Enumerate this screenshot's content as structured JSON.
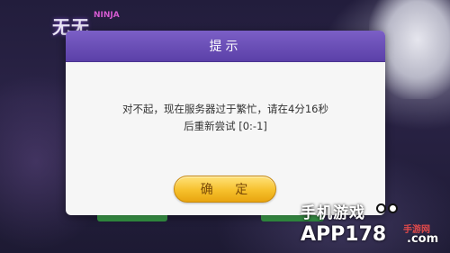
{
  "background": {
    "logo_text": "无无",
    "logo_sub": "NINJA"
  },
  "dialog": {
    "title": "提示",
    "message_line1": "对不起，现在服务器过于繁忙，请在4分16秒",
    "message_line2": "后重新尝试 [0:-1]",
    "ok_label": "确 定",
    "colors": {
      "header": "#6a4fba",
      "button": "#f6c02c",
      "body": "#f6f6f6"
    }
  },
  "watermark": {
    "cn": "手机游戏",
    "tag": "手游网",
    "domain": "APP178",
    "domain_suffix": ".com"
  }
}
